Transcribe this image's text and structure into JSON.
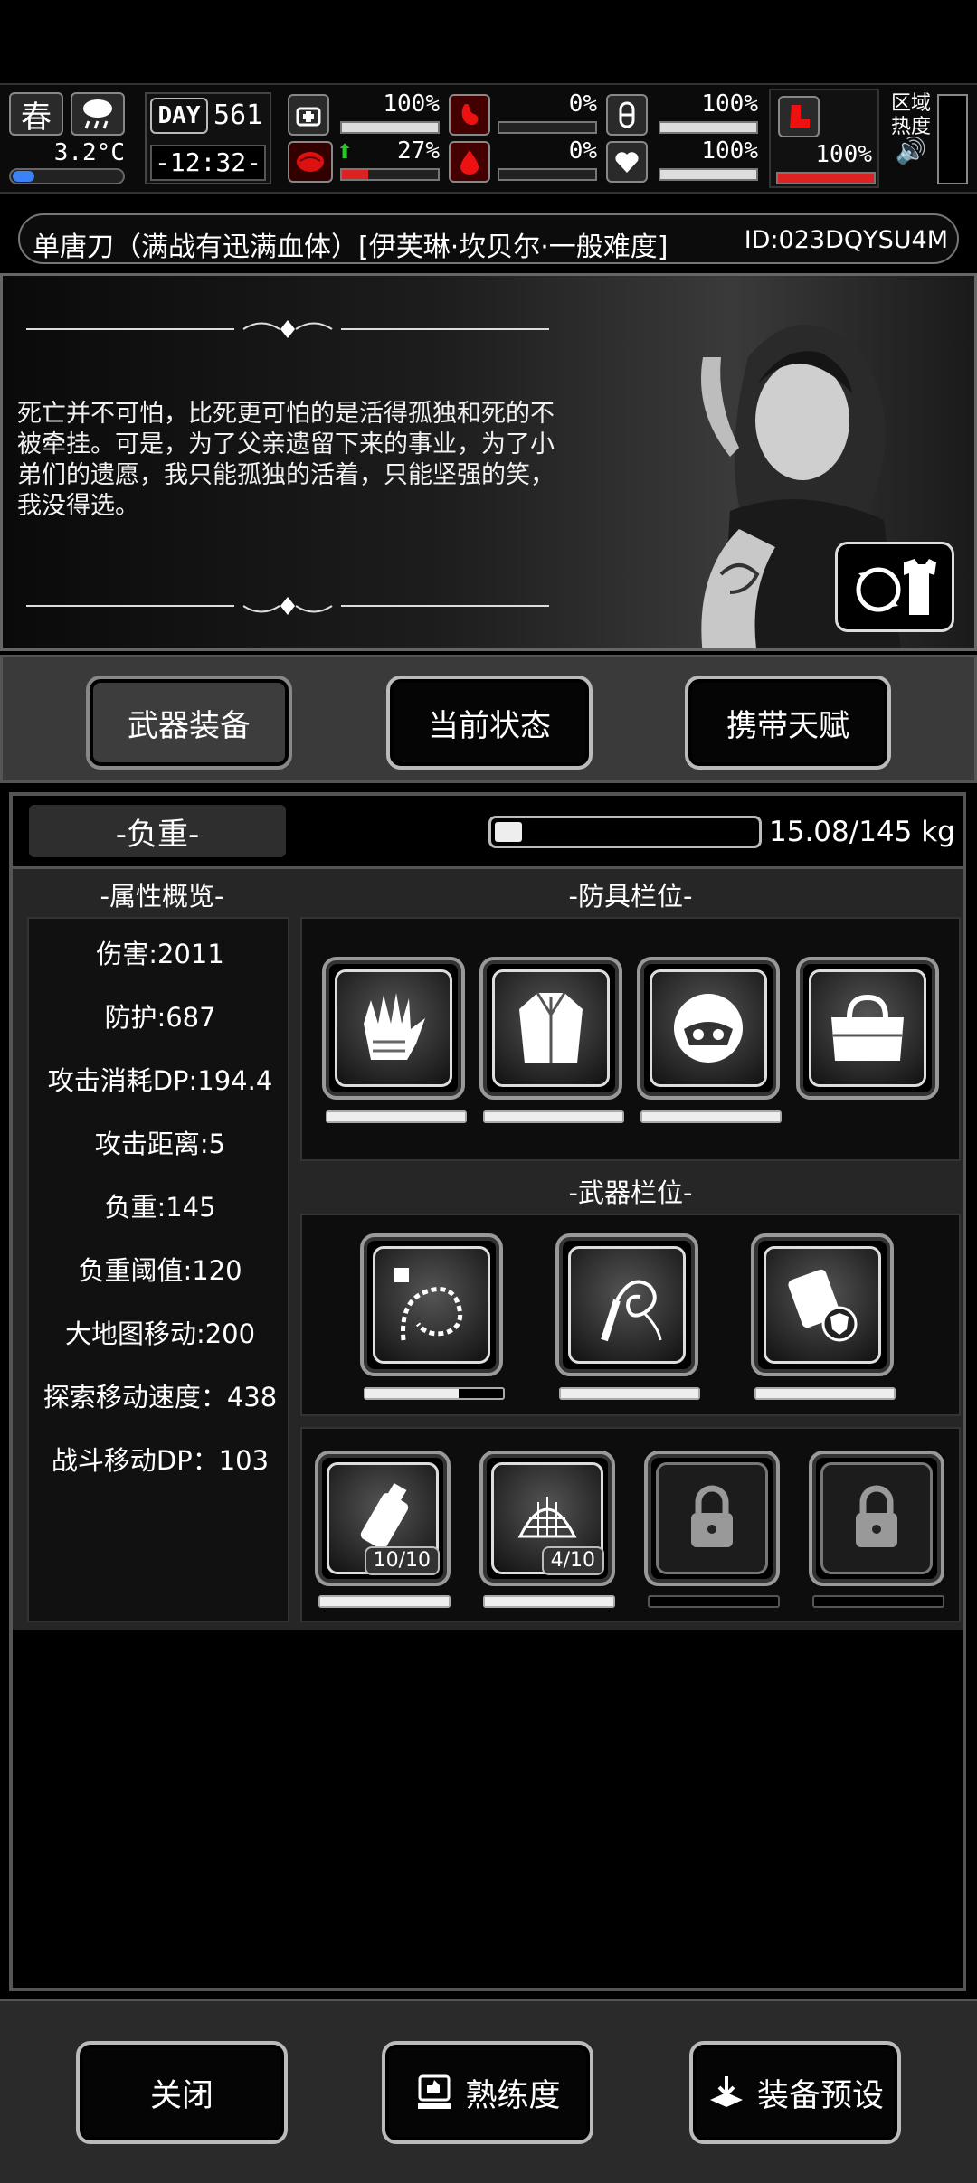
{
  "hud": {
    "season": "春",
    "temperature": "3.2°C",
    "day_label": "DAY",
    "day_number": "561",
    "clock": "-12:32-",
    "stats": [
      {
        "name": "health",
        "value": "100%",
        "fill": 1.0
      },
      {
        "name": "hunger",
        "value": "0%",
        "fill": 0.0
      },
      {
        "name": "stamina",
        "value": "100%",
        "fill": 1.0
      },
      {
        "name": "sanity",
        "value": "27%",
        "fill": 0.27
      },
      {
        "name": "bleeding",
        "value": "0%",
        "fill": 0.0
      },
      {
        "name": "heart",
        "value": "100%",
        "fill": 1.0
      },
      {
        "name": "leg",
        "value": "100%",
        "fill": 1.0
      }
    ],
    "region_label_1": "区域",
    "region_label_2": "热度"
  },
  "title": {
    "text": "单唐刀（满战有迅满血体）[伊芙琳·坎贝尔·一般难度]",
    "id": "ID:023DQYSU4M"
  },
  "portrait": {
    "quote": "死亡并不可怕，比死更可怕的是活得孤独和死的不被牵挂。可是，为了父亲遗留下来的事业，为了小弟们的遗愿，我只能孤独的活着，只能坚强的笑，我没得选。"
  },
  "tabs": {
    "weapons": "武器装备",
    "status": "当前状态",
    "talents": "携带天赋"
  },
  "weight": {
    "label": "-负重-",
    "value": "15.08/145 kg",
    "fill": 0.104
  },
  "attributes": {
    "heading": "-属性概览-",
    "items": [
      "伤害:2011",
      "防护:687",
      "攻击消耗DP:194.4",
      "攻击距离:5",
      "负重:145",
      "负重阈值:120",
      "大地图移动:200",
      "探索移动速度：438",
      "战斗移动DP：103"
    ]
  },
  "armor": {
    "heading": "-防具栏位-",
    "slots": [
      {
        "icon": "gloves-icon",
        "durability": 1.0
      },
      {
        "icon": "coat-icon",
        "durability": 1.0
      },
      {
        "icon": "helmet-icon",
        "durability": 1.0
      },
      {
        "icon": "bag-icon",
        "durability": null
      }
    ]
  },
  "weapons": {
    "heading": "-武器栏位-",
    "slots": [
      {
        "icon": "chain-whip-icon",
        "durability": 0.68
      },
      {
        "icon": "whip-icon",
        "durability": 1.0
      },
      {
        "icon": "armor-plate-icon",
        "durability": 1.0
      }
    ]
  },
  "items": {
    "slots": [
      {
        "icon": "bottle-icon",
        "count": "10/10",
        "fill": 1.0
      },
      {
        "icon": "net-icon",
        "count": "4/10",
        "fill": 1.0
      },
      {
        "icon": "lock-icon",
        "count": null,
        "fill": 0
      },
      {
        "icon": "lock-icon",
        "count": null,
        "fill": 0
      }
    ]
  },
  "bottom": {
    "close": "关闭",
    "proficiency": "熟练度",
    "preset": "装备预设"
  }
}
